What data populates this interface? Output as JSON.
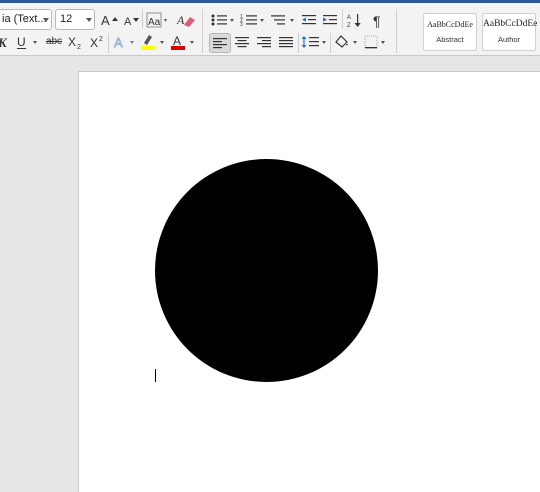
{
  "ribbon": {
    "font_name": "ia (Text...",
    "font_size": "12",
    "strike_label": "abc",
    "styles": [
      {
        "sample": "AaBbCcDdEe",
        "name": "Abstract"
      },
      {
        "sample": "AaBbCcDdEe",
        "name": "Author"
      }
    ]
  },
  "colors": {
    "highlight": "#ffff00",
    "font_color": "#e00000",
    "accent": "#2b579a"
  },
  "document": {
    "shape": "black-filled-circle"
  }
}
